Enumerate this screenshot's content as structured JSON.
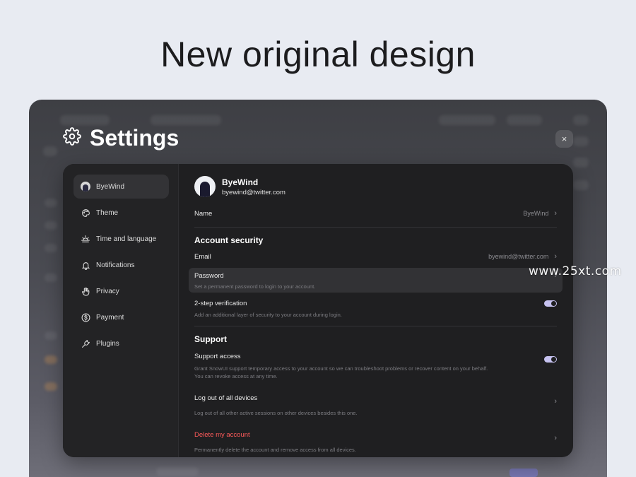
{
  "headline": "New original design",
  "settings": {
    "title": "Settings",
    "close_icon": "×"
  },
  "sidebar": {
    "items": [
      {
        "label": "ByeWind",
        "icon": "avatar",
        "active": true
      },
      {
        "label": "Theme",
        "icon": "palette-icon"
      },
      {
        "label": "Time and language",
        "icon": "sunrise-icon"
      },
      {
        "label": "Notifications",
        "icon": "bell-icon"
      },
      {
        "label": "Privacy",
        "icon": "hand-icon"
      },
      {
        "label": "Payment",
        "icon": "dollar-circle-icon"
      },
      {
        "label": "Plugins",
        "icon": "plug-icon"
      }
    ]
  },
  "profile": {
    "name": "ByeWind",
    "email": "byewind@twitter.com"
  },
  "name_row": {
    "label": "Name",
    "value": "ByeWind"
  },
  "account_security": {
    "title": "Account security",
    "email": {
      "label": "Email",
      "value": "byewind@twitter.com"
    },
    "password": {
      "label": "Password",
      "desc": "Set a permanent password to login to your account."
    },
    "two_step": {
      "label": "2-step verification",
      "desc": "Add an additional layer of security to your account during login.",
      "enabled": true
    }
  },
  "support": {
    "title": "Support",
    "access": {
      "label": "Support access",
      "desc1": "Grant SnowUI support temporary access to your account so we can troubleshoot problems or recover content on your behalf.",
      "desc2": "You can revoke access at any time.",
      "enabled": true
    },
    "logout": {
      "label": "Log out of all devices",
      "desc": "Log out of all other active sessions on other devices besides this one."
    },
    "delete": {
      "label": "Delete my account",
      "desc": "Permanently delete the account and remove access from all devices.",
      "color": "#ff5b5b"
    }
  },
  "watermark": "www.25xt.com",
  "colors": {
    "accent": "#c6c2f0",
    "panel": "#1f1f21",
    "danger": "#ff5b5b"
  }
}
